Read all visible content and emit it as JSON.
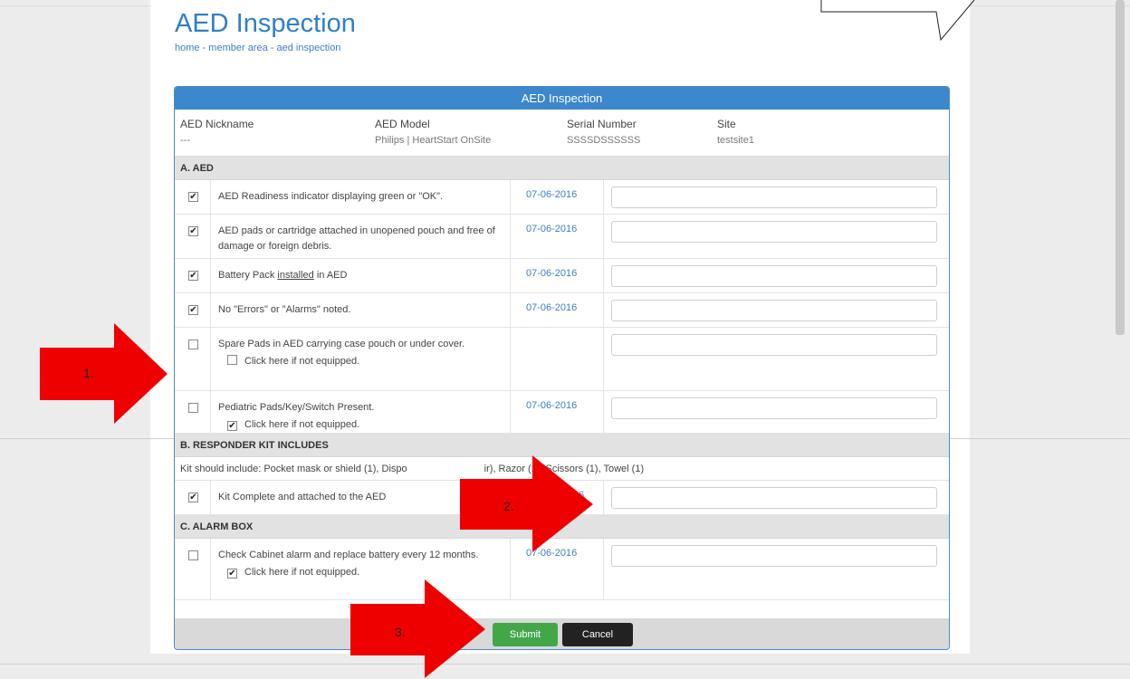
{
  "page": {
    "title": "AED Inspection",
    "breadcrumb": "home - member area - aed inspection"
  },
  "panel": {
    "header": "AED Inspection",
    "info": {
      "nickname_label": "AED Nickname",
      "nickname_value": "---",
      "model_label": "AED Model",
      "model_value": "Philips | HeartStart OnSite",
      "serial_label": "Serial Number",
      "serial_value": "SSSSDSSSSSS",
      "site_label": "Site",
      "site_value": "testsite1"
    }
  },
  "sections": {
    "a": "A. AED",
    "b": "B. RESPONDER KIT INCLUDES",
    "b_note": "Kit should include: Pocket mask or shield (1), Dispo",
    "b_note_tail": "ir), Razor (1), Scissors (1), Towel (1)",
    "c": "C. ALARM BOX"
  },
  "items": [
    {
      "text": "AED Readiness indicator displaying green or \"OK\".",
      "checked": true,
      "date": "07-06-2016"
    },
    {
      "text": "AED pads or cartridge attached in unopened pouch and free of damage or foreign debris.",
      "checked": true,
      "date": "07-06-2016"
    },
    {
      "text_pre": "Battery Pack ",
      "text_link": "installed",
      "text_post": " in AED",
      "checked": true,
      "date": "07-06-2016"
    },
    {
      "text": "No \"Errors\" or \"Alarms\" noted.",
      "checked": true,
      "date": "07-06-2016"
    },
    {
      "text": "Spare Pads in AED carrying case pouch or under cover.",
      "checked": false,
      "date": "",
      "sub_label": "Click here if not equipped.",
      "sub_checked": false
    },
    {
      "text": "Pediatric Pads/Key/Switch Present.",
      "checked": false,
      "date": "07-06-2016",
      "sub_label": "Click here if not equipped.",
      "sub_checked": true
    },
    {
      "text": "Kit Complete and attached to the AED",
      "checked": true,
      "date": "6"
    },
    {
      "text": "Check Cabinet alarm and replace battery every 12 months.",
      "checked": false,
      "date": "07-06-2016",
      "sub_label": "Click here if not equipped.",
      "sub_checked": true
    }
  ],
  "buttons": {
    "submit": "Submit",
    "cancel": "Cancel"
  },
  "annotations": {
    "arrow1": "1.",
    "arrow2": "2.",
    "arrow3": "3.",
    "arrow_color": "#ee0000"
  },
  "colors": {
    "accent": "#3d87cd",
    "submit": "#43a74a",
    "cancel": "#222222"
  }
}
